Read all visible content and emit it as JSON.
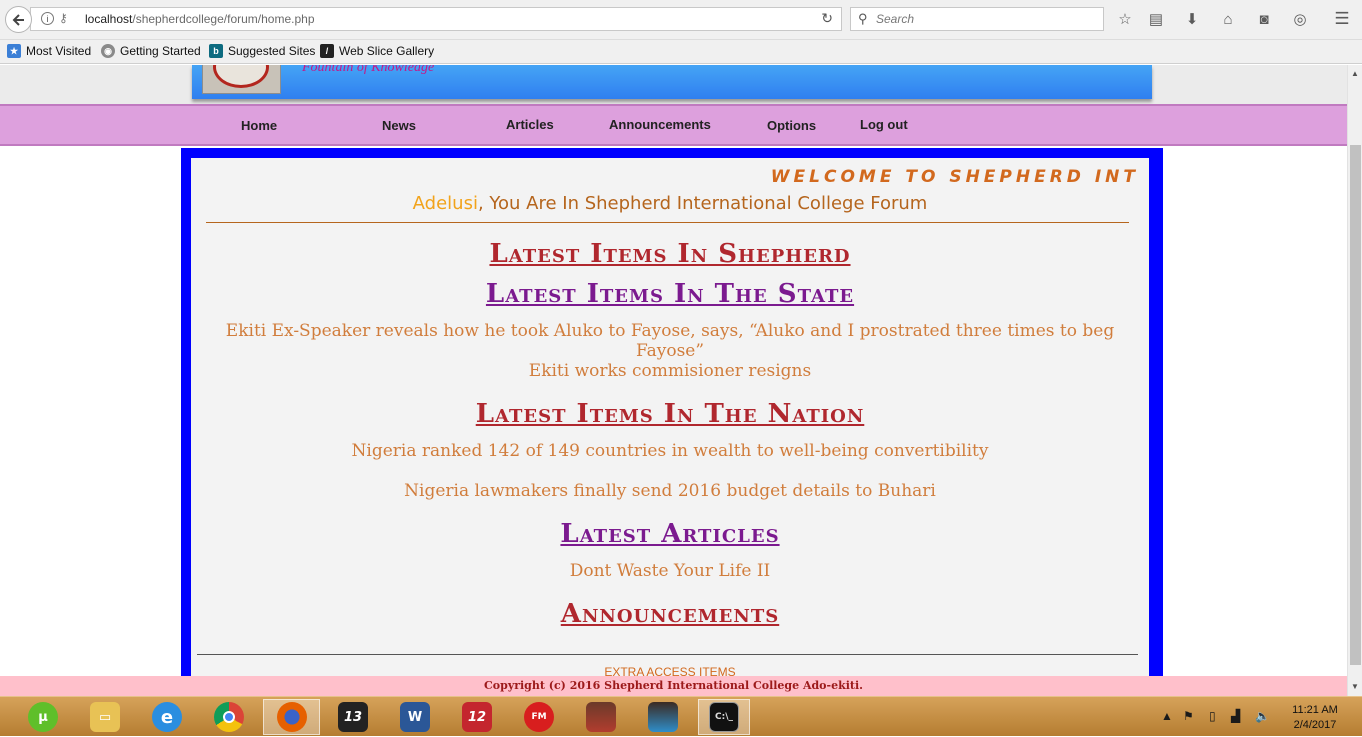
{
  "browser": {
    "url_host": "localhost",
    "url_path": "/shepherdcollege/forum/home.php",
    "search_placeholder": "Search",
    "bookmarks": [
      "Most Visited",
      "Getting Started",
      "Suggested Sites",
      "Web Slice Gallery"
    ]
  },
  "site": {
    "motto": "Fountain of Knowledge",
    "nav": [
      "Home",
      "News",
      "Articles",
      "Announcements",
      "Options",
      "Log out"
    ],
    "marquee": "WELCOME TO SHEPHERD INT",
    "welcome_user": "Adelusi",
    "welcome_rest": ", You Are In Shepherd International College Forum",
    "sections": {
      "shepherd_title": "Latest Items In Shepherd",
      "state_title": "Latest Items In The State",
      "state_items": [
        "Ekiti Ex-Speaker reveals how he took Aluko to Fayose, says, “Aluko and I prostrated three times to beg Fayose”",
        "Ekiti works commisioner resigns"
      ],
      "nation_title": "Latest Items In The Nation",
      "nation_items": [
        "Nigeria ranked 142 of 149 countries in wealth to well-being convertibility",
        "Nigeria lawmakers finally send 2016 budget details to Buhari"
      ],
      "articles_title": "Latest Articles",
      "articles_items": [
        "Dont Waste Your Life II"
      ],
      "announcements_title": "Announcements"
    },
    "extra_access": "EXTRA ACCESS ITEMS",
    "footer": "Copyright (c) 2016 Shepherd International College Ado-ekiti."
  },
  "taskbar": {
    "apps": [
      "utorrent",
      "file-explorer",
      "internet-explorer",
      "chrome",
      "firefox",
      "13",
      "word",
      "12",
      "fm-radio",
      "player-1",
      "player-2",
      "cmd"
    ],
    "time": "11:21 AM",
    "date": "2/4/2017"
  },
  "colors": {
    "nav_bg": "#dda0dd",
    "content_border": "#0000ff",
    "heading_red": "#b0272e",
    "heading_purple": "#7b1a8f",
    "item_text": "#d17d3c",
    "footer_bg": "#ffc0cb"
  }
}
